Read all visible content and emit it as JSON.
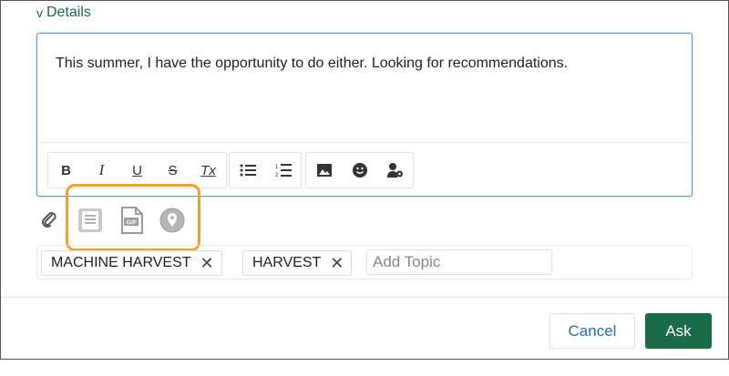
{
  "details": {
    "chevron": "v",
    "label": "Details"
  },
  "editor": {
    "text": "This summer, I have the opportunity to do either. Looking for recommendations.",
    "toolbar": {
      "bold": "B",
      "italic": "I",
      "underline": "U",
      "strike": "S",
      "clear_format": "Tx"
    }
  },
  "attachments": {
    "icons": [
      "paperclip-icon",
      "document-icon",
      "gif-icon",
      "location-pin-icon"
    ],
    "highlight_color": "#f4a02c"
  },
  "topics": {
    "chips": [
      "MACHINE HARVEST",
      "HARVEST"
    ],
    "remove_glyph": "✕",
    "placeholder": "Add Topic"
  },
  "footer": {
    "cancel_label": "Cancel",
    "ask_label": "Ask"
  },
  "colors": {
    "brand_green": "#1a6b47",
    "link_blue": "#2b6cb0",
    "focus_blue": "#5aa0e0"
  }
}
